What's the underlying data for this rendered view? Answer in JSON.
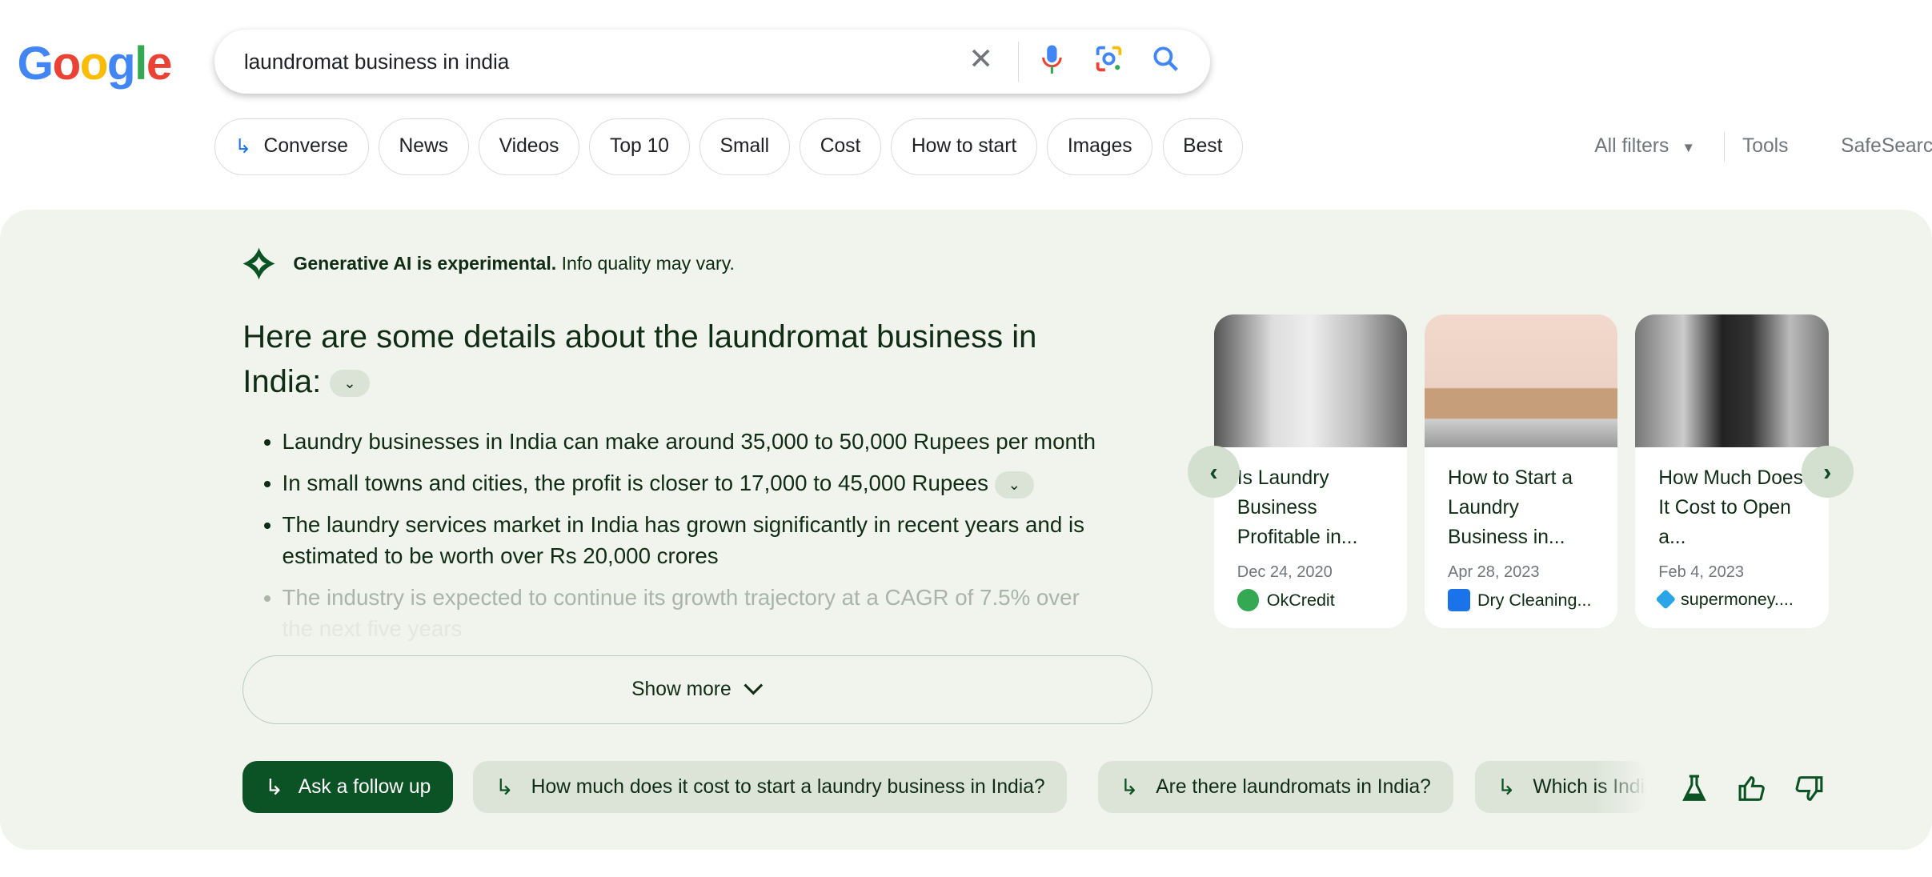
{
  "logo": {
    "text": "Google",
    "colors": [
      "#4285F4",
      "#EA4335",
      "#FBBC05",
      "#4285F4",
      "#34A853",
      "#EA4335"
    ]
  },
  "search": {
    "query": "laundromat business in india"
  },
  "chips": [
    "Converse",
    "News",
    "Videos",
    "Top 10",
    "Small",
    "Cost",
    "How to start",
    "Images",
    "Best"
  ],
  "tools": {
    "all_filters": "All filters",
    "tools": "Tools",
    "safesearch": "SafeSearch"
  },
  "sge": {
    "notice_bold": "Generative AI is experimental.",
    "notice_rest": " Info quality may vary.",
    "heading": "Here are some details about the laundromat business in India:",
    "bullets": [
      "Laundry businesses in India can make around 35,000 to 50,000 Rupees per month",
      "In small towns and cities, the profit is closer to 17,000 to 45,000 Rupees",
      "The laundry services market in India has grown significantly in recent years and is estimated to be worth over Rs 20,000 crores",
      "The industry is expected to continue its growth trajectory at a CAGR of 7.5% over",
      "the next five years"
    ],
    "show_more": "Show more",
    "cards": [
      {
        "title": "Is Laundry Business Profitable in...",
        "date": "Dec 24, 2020",
        "source": "OkCredit",
        "fav_color": "#34a853"
      },
      {
        "title": "How to Start a Laundry Business in...",
        "date": "Apr 28, 2023",
        "source": "Dry Cleaning...",
        "fav_color": "#1a73e8"
      },
      {
        "title": "How Much Does It Cost to Open a...",
        "date": "Feb 4, 2023",
        "source": "supermoney....",
        "fav_color": "#2aa5e8"
      }
    ],
    "ask_follow_up": "Ask a follow up",
    "suggestions": [
      "How much does it cost to start a laundry business in India?",
      "Are there laundromats in India?",
      "Which is India"
    ],
    "accent": "#0b5224"
  }
}
